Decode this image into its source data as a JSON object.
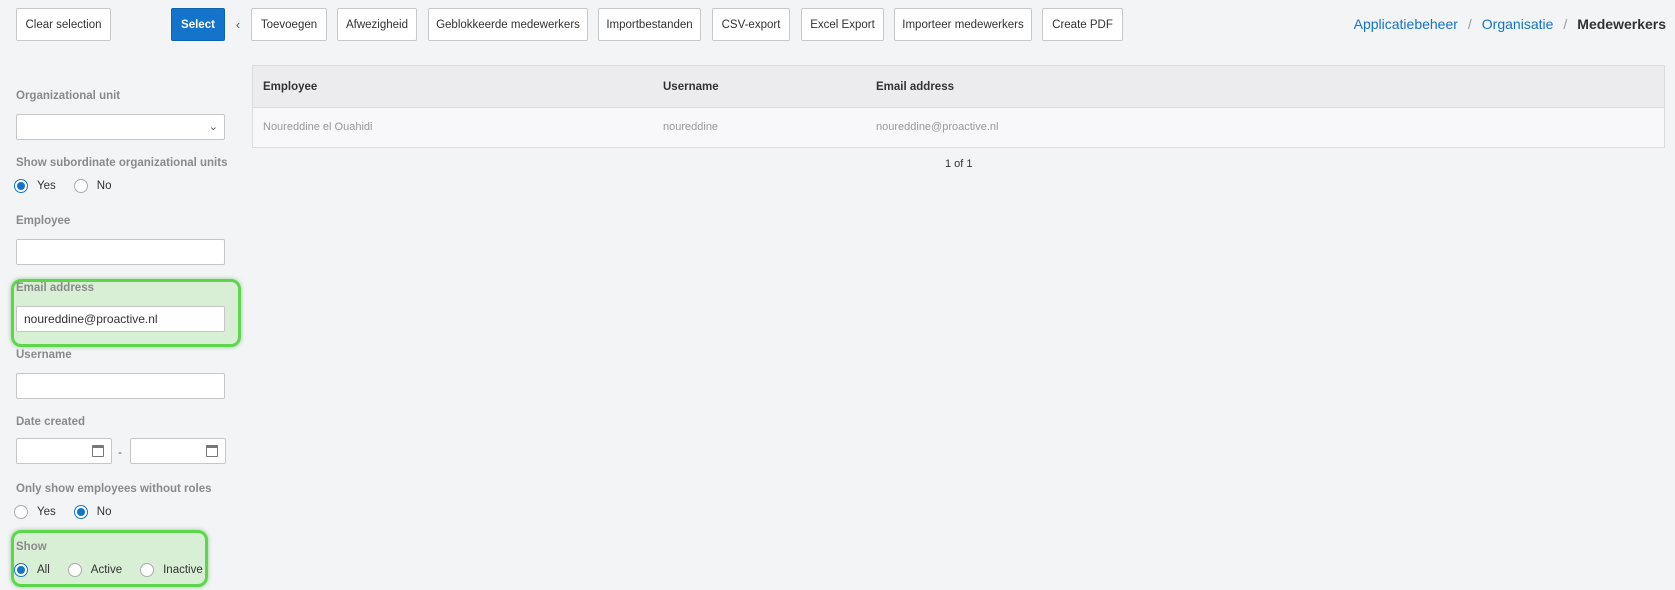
{
  "toolbar": {
    "clear_selection": "Clear selection",
    "select": "Select",
    "back_icon": "chevron-left-icon",
    "buttons": [
      "Toevoegen",
      "Afwezigheid",
      "Geblokkeerde medewerkers",
      "Importbestanden",
      "CSV-export",
      "Excel Export",
      "Importeer medewerkers",
      "Create PDF"
    ]
  },
  "breadcrumb": {
    "items": [
      "Applicatiebeheer",
      "Organisatie"
    ],
    "separator": "/",
    "current": "Medewerkers"
  },
  "filters": {
    "org_unit": {
      "label": "Organizational unit",
      "value": ""
    },
    "subordinate": {
      "label": "Show subordinate organizational units",
      "options": [
        "Yes",
        "No"
      ],
      "selected": "Yes"
    },
    "employee": {
      "label": "Employee",
      "value": ""
    },
    "email": {
      "label": "Email address",
      "value": "noureddine@proactive.nl"
    },
    "username": {
      "label": "Username",
      "value": ""
    },
    "date_created": {
      "label": "Date created",
      "from": "",
      "to": "",
      "separator": "-"
    },
    "without_roles": {
      "label": "Only show employees without roles",
      "options": [
        "Yes",
        "No"
      ],
      "selected": "No"
    },
    "show": {
      "label": "Show",
      "options": [
        "All",
        "Active",
        "Inactive"
      ],
      "selected": "All"
    }
  },
  "table": {
    "columns": [
      "Employee",
      "Username",
      "Email address"
    ],
    "rows": [
      [
        "Noureddine el Ouahidi",
        "noureddine",
        "noureddine@proactive.nl"
      ]
    ]
  },
  "pager": {
    "text": "1 of 1"
  },
  "colors": {
    "primary": "#1474cc",
    "highlight": "#5cd64a",
    "background": "#f3f4f6"
  }
}
